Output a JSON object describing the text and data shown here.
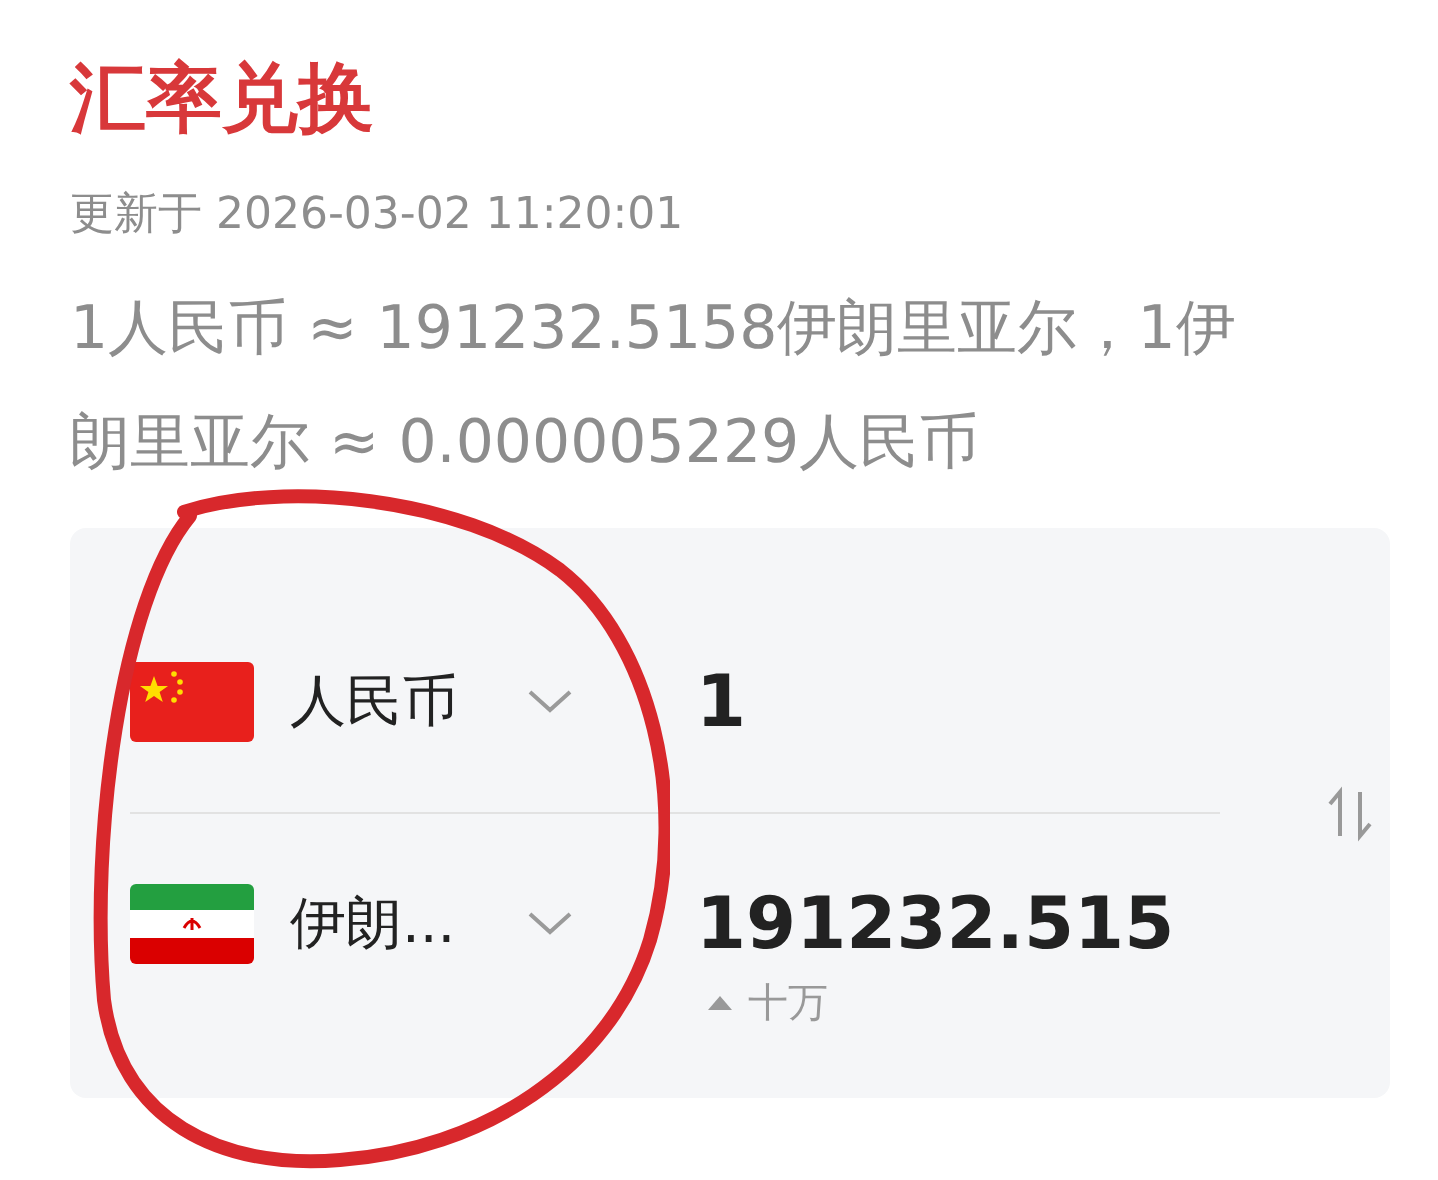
{
  "title": "汇率兑换",
  "updated": "更新于 2026-03-02 11:20:01",
  "rate_text": "1人民币 ≈ 191232.5158伊朗里亚尔，1伊朗里亚尔 ≈ 0.000005229人民币",
  "currencies": [
    {
      "kind": "cn",
      "name": "人民币",
      "amount": "1"
    },
    {
      "kind": "ir",
      "name": "伊朗...",
      "amount": "191232.515",
      "unit_hint": "十万"
    }
  ]
}
